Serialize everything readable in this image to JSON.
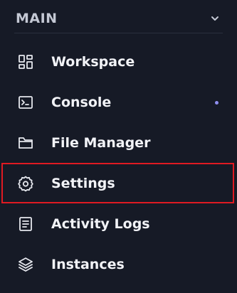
{
  "section": {
    "title": "MAIN",
    "toggle_icon": "chevron-down-icon"
  },
  "nav": {
    "items": [
      {
        "label": "Workspace",
        "icon": "dashboard-grid-icon",
        "selected": false,
        "has_indicator": false
      },
      {
        "label": "Console",
        "icon": "terminal-icon",
        "selected": false,
        "has_indicator": true
      },
      {
        "label": "File Manager",
        "icon": "folder-icon",
        "selected": false,
        "has_indicator": false
      },
      {
        "label": "Settings",
        "icon": "gear-icon",
        "selected": true,
        "has_indicator": false
      },
      {
        "label": "Activity Logs",
        "icon": "document-list-icon",
        "selected": false,
        "has_indicator": false
      },
      {
        "label": "Instances",
        "icon": "layers-icon",
        "selected": false,
        "has_indicator": false
      }
    ]
  },
  "colors": {
    "background": "#161a26",
    "text": "#f2f3f7",
    "section_text": "#c4c8d4",
    "selection_border": "#e01a22",
    "indicator_dot": "#8f8ff0"
  }
}
